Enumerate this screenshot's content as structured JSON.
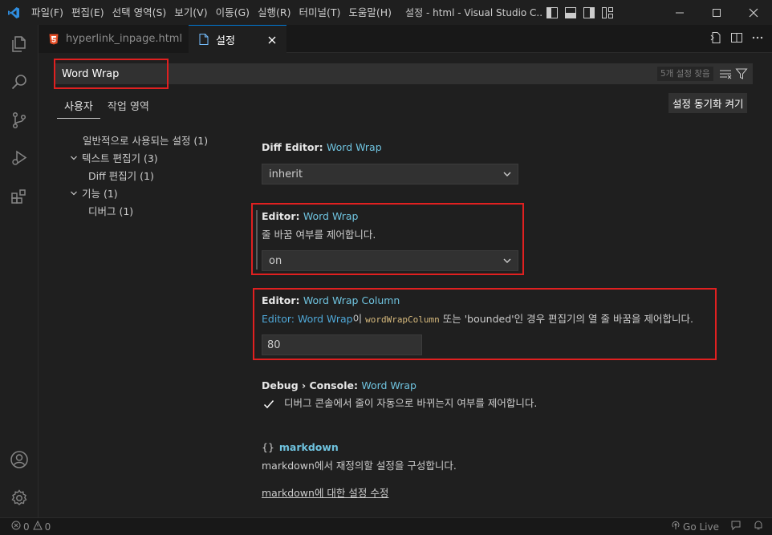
{
  "titlebar": {
    "menu": [
      "파일(F)",
      "편집(E)",
      "선택 영역(S)",
      "보기(V)",
      "이동(G)",
      "실행(R)",
      "터미널(T)",
      "도움말(H)"
    ],
    "window_title": "설정 - html - Visual Studio C..."
  },
  "tabs": [
    {
      "label": "hyperlink_inpage.html",
      "icon": "html5-icon",
      "active": false
    },
    {
      "label": "설정",
      "icon": "file-icon",
      "active": true
    }
  ],
  "search": {
    "value": "Word Wrap",
    "result_count": "5개 설정 찾음"
  },
  "scope_tabs": [
    "사용자",
    "작업 영역"
  ],
  "sync_button": "설정 동기화 켜기",
  "toc": {
    "items": [
      {
        "label": "일반적으로 사용되는 설정 (1)"
      },
      {
        "label": "텍스트 편집기 (3)"
      },
      {
        "label": "Diff 편집기 (1)"
      },
      {
        "label": "기능 (1)"
      },
      {
        "label": "디버그 (1)"
      }
    ]
  },
  "settings": {
    "diff_word_wrap": {
      "category": "Diff Editor: ",
      "key": "Word Wrap",
      "value": "inherit"
    },
    "editor_word_wrap": {
      "category": "Editor: ",
      "key": "Word Wrap",
      "description": "줄 바꿈 여부를 제어합니다.",
      "value": "on"
    },
    "editor_word_wrap_column": {
      "category": "Editor: ",
      "key": "Word Wrap Column",
      "desc_link": "Editor: Word Wrap",
      "desc_part1": "이 ",
      "desc_code": "wordWrapColumn",
      "desc_part2": " 또는 'bounded'인 경우 편집기의 열 줄 바꿈을 제어합니다.",
      "value": "80"
    },
    "debug_console_word_wrap": {
      "category": "Debug › Console: ",
      "key": "Word Wrap",
      "description": "디버그 콘솔에서 줄이 자동으로 바뀌는지 여부를 제어합니다.",
      "checked": true
    },
    "markdown": {
      "braces": "{}",
      "title": "markdown",
      "description": "markdown에서 재정의할 설정을 구성합니다.",
      "link": "markdown에 대한 설정 수정"
    }
  },
  "statusbar": {
    "errors": "0",
    "warnings": "0",
    "go_live": "Go Live"
  },
  "colors": {
    "accent": "#0078d4",
    "highlight_box": "#e02020",
    "setting_key": "#6fc3df"
  }
}
